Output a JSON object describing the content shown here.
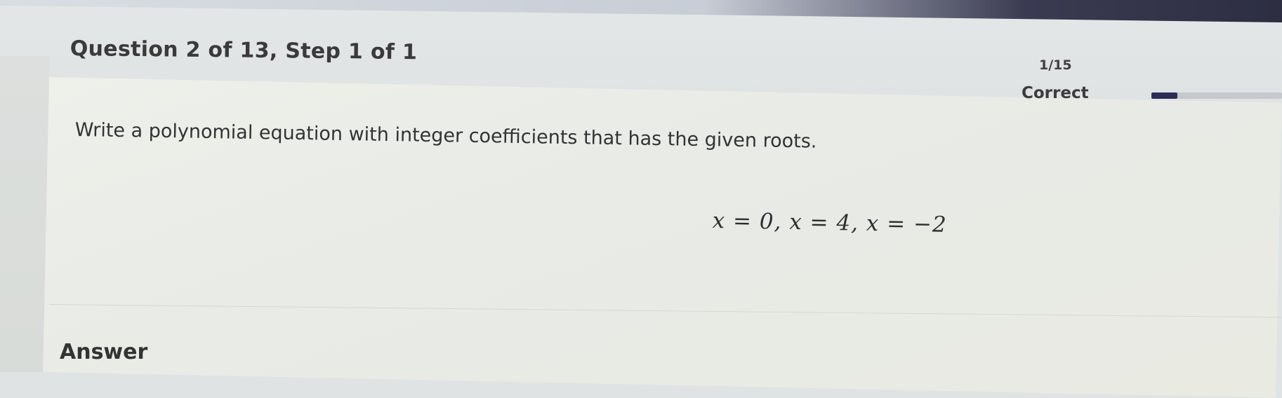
{
  "header": {
    "question_title": "Question 2 of 13,  Step 1 of 1",
    "score": "1/15",
    "status": "Correct",
    "progress_fraction": 0.2
  },
  "question": {
    "prompt": "Write a polynomial equation with integer coefficients that has the given roots.",
    "roots_equation": "x = 0, x = 4, x = −2"
  },
  "answer": {
    "label": "Answer"
  },
  "colors": {
    "progress_fill": "#2b2d55",
    "header_dark": "#2d2e42"
  }
}
